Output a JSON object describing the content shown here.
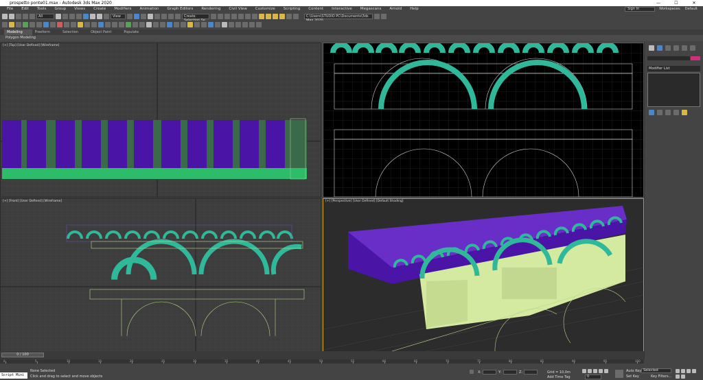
{
  "app": {
    "title": "prospetto ponte01.max - Autodesk 3ds Max 2020",
    "window_controls": [
      "—",
      "☐",
      "✕"
    ]
  },
  "menu": {
    "items": [
      "File",
      "Edit",
      "Tools",
      "Group",
      "Views",
      "Create",
      "Modifiers",
      "Animation",
      "Graph Editors",
      "Rendering",
      "Civil View",
      "Customize",
      "Scripting",
      "Content",
      "Interactive",
      "Megascans",
      "Arnold",
      "Help"
    ],
    "sign_in": "Sign In",
    "workspaces_label": "Workspaces:",
    "workspace_value": "Default"
  },
  "toolbar": {
    "all_filter": "All",
    "view_dropdown": "View",
    "selection_set": "Create Selection Se",
    "path": "C:\\Users\\STUDIO PC\\Documents\\3ds Max 2020"
  },
  "ribbon": {
    "tabs": [
      "Modeling",
      "Freeform",
      "Selection",
      "Object Paint",
      "Populate"
    ],
    "sub": "Polygon Modeling"
  },
  "viewports": {
    "top": "[+] [Top] [User Defined] [Wireframe]",
    "front": "[+] [Front] [User Defined] [Wireframe]",
    "perspective": "[+] [Perspective] [User Defined] [Default Shading]"
  },
  "command_panel": {
    "modifier_list": "Modifier List"
  },
  "timeline": {
    "frame": "0 / 100",
    "ticks": [
      "0",
      "5",
      "10",
      "15",
      "20",
      "25",
      "30",
      "35",
      "40",
      "45",
      "50",
      "55",
      "60",
      "65",
      "70",
      "75",
      "80",
      "85",
      "90",
      "95",
      "100"
    ]
  },
  "status": {
    "maxscript": "Script Mini",
    "selection": "None Selected",
    "prompt": "Click and drag to select and move objects",
    "x_label": "X:",
    "y_label": "Y:",
    "z_label": "Z:",
    "grid": "Grid = 10,0m",
    "add_time_tag": "Add Time Tag",
    "auto_key": "Auto Key",
    "set_key": "Set Key",
    "selected": "Selected",
    "key_filters": "Key Filters...",
    "frame_value": "0"
  },
  "colors": {
    "purple": "#4a14a6",
    "teal": "#2fb89a",
    "green": "#2dbd6a",
    "yellowgreen": "#d4eaa0",
    "accent": "#d0307a"
  }
}
